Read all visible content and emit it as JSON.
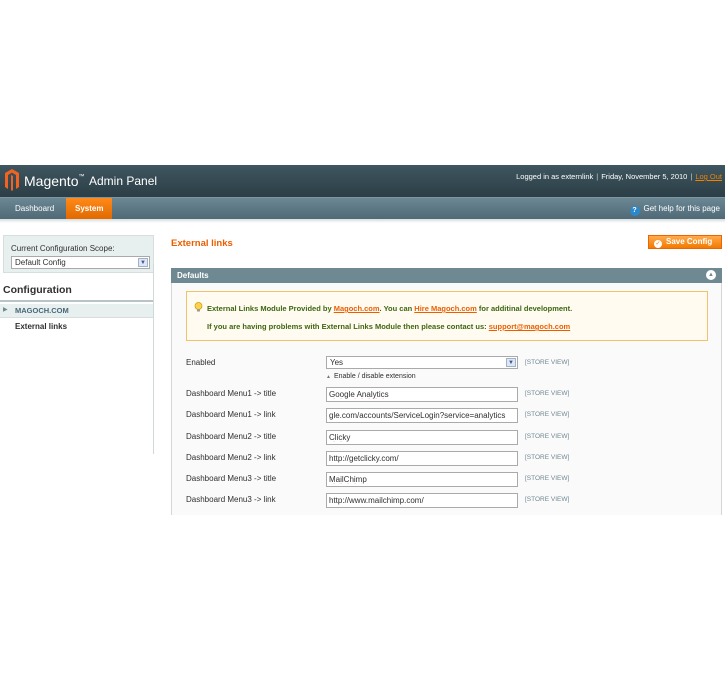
{
  "header": {
    "logo_name": "Magento",
    "logo_tm": "™",
    "logo_sub": "Admin Panel",
    "logged_in": "Logged in as externlink",
    "separator": "|",
    "date": "Friday, November 5, 2010",
    "logout": "Log Out"
  },
  "nav": {
    "items": [
      {
        "label": "Dashboard"
      },
      {
        "label": "System",
        "active": true
      }
    ],
    "help": "Get help for this page"
  },
  "sidebar": {
    "scope_label": "Current Configuration Scope:",
    "scope_value": "Default Config",
    "title": "Configuration",
    "group": "MAGOCH.COM",
    "item": "External links"
  },
  "main": {
    "page_title": "External links",
    "save_button": "Save Config",
    "section_title": "Defaults",
    "notice": {
      "line1_pre": "External Links Module Provided by ",
      "line1_link1": "Magoch.com",
      "line1_mid": ". You can ",
      "line1_link2": "Hire Magoch.com",
      "line1_post": " for additinal development.",
      "line2_pre": "If you are having problems with External Links Module then please contact us: ",
      "line2_link": "support@magoch.com"
    },
    "fields": [
      {
        "label": "Enabled",
        "type": "select",
        "value": "Yes",
        "scope": "[STORE VIEW]",
        "hint": "Enable / disable extension"
      },
      {
        "label": "Dashboard Menu1 -> title",
        "type": "text",
        "value": "Google Analytics",
        "scope": "[STORE VIEW]"
      },
      {
        "label": "Dashboard Menu1 -> link",
        "type": "text",
        "value": "gle.com/accounts/ServiceLogin?service=analytics",
        "scope": "[STORE VIEW]"
      },
      {
        "label": "Dashboard Menu2 -> title",
        "type": "text",
        "value": "Clicky",
        "scope": "[STORE VIEW]"
      },
      {
        "label": "Dashboard Menu2 -> link",
        "type": "text",
        "value": "http://getclicky.com/",
        "scope": "[STORE VIEW]"
      },
      {
        "label": "Dashboard Menu3 -> title",
        "type": "text",
        "value": "MailChimp",
        "scope": "[STORE VIEW]"
      },
      {
        "label": "Dashboard Menu3 -> link",
        "type": "text",
        "value": "http://www.mailchimp.com/",
        "scope": "[STORE VIEW]"
      }
    ]
  },
  "colors": {
    "header_bg": "#2c3e46",
    "nav_bg": "#5a7580",
    "accent": "#eb5e00",
    "section_head": "#6f8992",
    "notice_text": "#3d6611"
  },
  "icons": [
    "magento-logo-icon",
    "help-icon",
    "save-icon",
    "collapse-icon",
    "lightbulb-icon",
    "chevron-down-icon",
    "triangle-right-icon"
  ]
}
